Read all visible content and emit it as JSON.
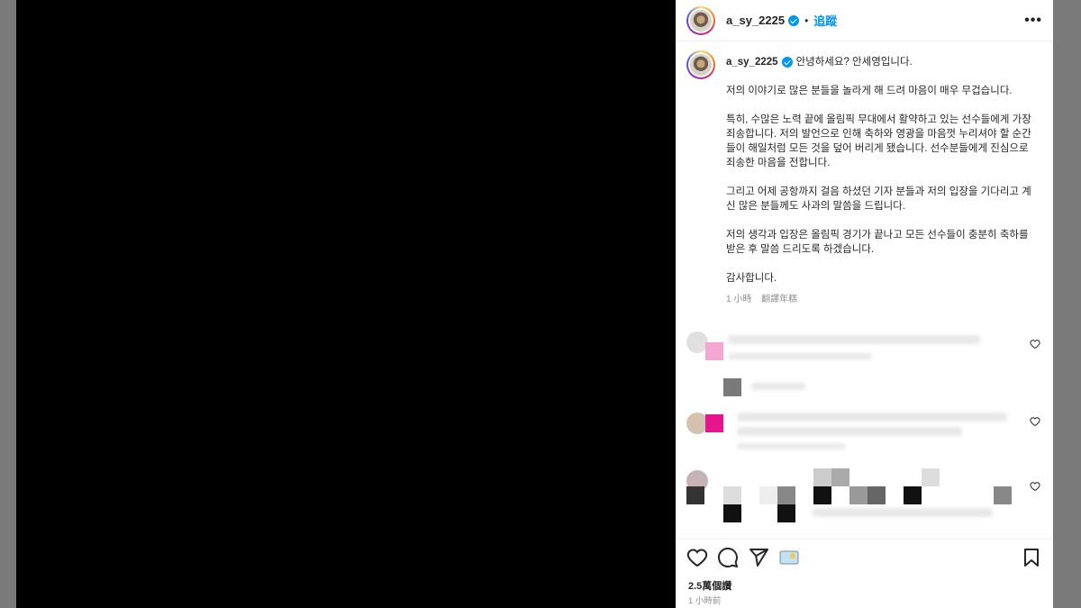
{
  "post": {
    "username": "a_sy_2225",
    "follow_label": "追蹤",
    "more_label": "•••"
  },
  "caption": {
    "username": "a_sy_2225",
    "greeting": "안녕하세요? 안세영입니다.",
    "paragraphs": [
      "저의 이야기로 많은 분들을 놀라게 해 드려 마음이 매우 무겁습니다.",
      "특히, 수많은 노력 끝에 올림픽 무대에서 활약하고 있는 선수들에게 가장 죄송합니다. 저의 발언으로 인해 축하와 영광을 마음껏 누리셔야 할 순간들이 해일처럼 모든 것을 덮어 버리게 됐습니다. 선수분들에게 진심으로 죄송한 마음을 전합니다.",
      "그리고 어제 공항까지 걸음 하셨던 기자 분들과 저의 입장을 기다리고 계신 많은 분들께도 사과의 말씀을 드립니다.",
      "저의 생각과 입장은 올림픽 경기가 끝나고 모든 선수들이 충분히 축하를 받은 후 말씀 드리도록 하겠습니다.",
      "감사합니다."
    ],
    "time": "1 小時",
    "translate": "翻譯年糕"
  },
  "footer": {
    "views": "2.5萬個讚",
    "time": "1 小時前"
  },
  "colors": {
    "accent": "#0095f6",
    "media_bg": "#000000",
    "panel_bg": "#ffffff"
  },
  "icons": [
    "heart-icon",
    "comment-icon",
    "share-icon",
    "save-icon",
    "verified-icon",
    "more-icon"
  ]
}
